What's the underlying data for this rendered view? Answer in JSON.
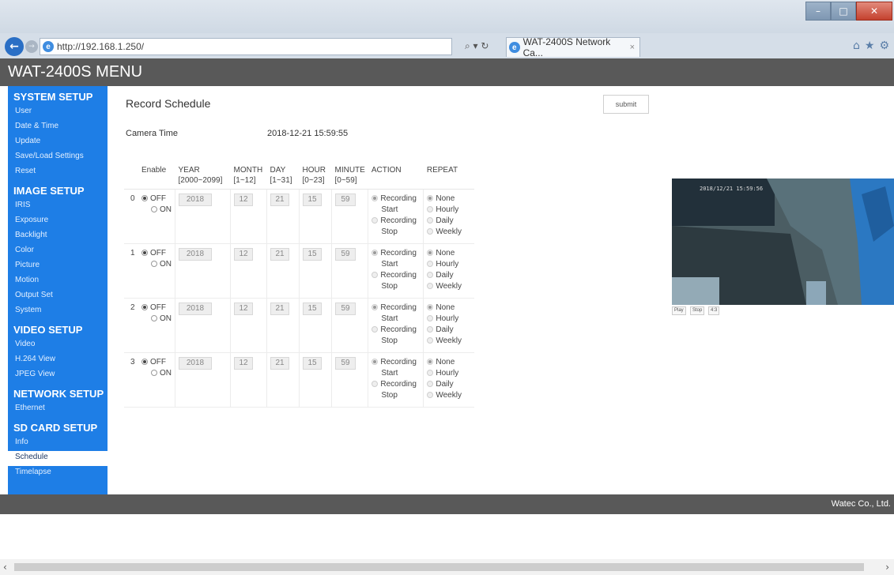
{
  "browser": {
    "url": "http://192.168.1.250/",
    "search_refresh": "⌕ ▾ ↻",
    "tab_title": "WAT-2400S Network Ca...",
    "tab_close": "×"
  },
  "app": {
    "header_title": "WAT-2400S MENU"
  },
  "sidebar": {
    "sections": [
      {
        "title": "SYSTEM SETUP",
        "items": [
          "User",
          "Date & Time",
          "Update",
          "Save/Load Settings",
          "Reset"
        ]
      },
      {
        "title": "IMAGE SETUP",
        "items": [
          "IRIS",
          "Exposure",
          "Backlight",
          "Color",
          "Picture",
          "Motion",
          "Output Set",
          "System"
        ]
      },
      {
        "title": "VIDEO SETUP",
        "items": [
          "Video",
          "H.264 View",
          "JPEG View"
        ]
      },
      {
        "title": "NETWORK SETUP",
        "items": [
          "Ethernet"
        ]
      },
      {
        "title": "SD CARD SETUP",
        "items": [
          "Info",
          "Schedule",
          "Timelapse"
        ]
      }
    ],
    "active_item": "Schedule"
  },
  "main": {
    "title": "Record Schedule",
    "submit_label": "submit",
    "camera_time_label": "Camera Time",
    "camera_time_value": "2018-12-21 15:59:55"
  },
  "schedule": {
    "headers": {
      "enable": "Enable",
      "year": "YEAR",
      "year_range": "[2000~2099]",
      "month": "MONTH",
      "month_range": "[1~12]",
      "day": "DAY",
      "day_range": "[1~31]",
      "hour": "HOUR",
      "hour_range": "[0~23]",
      "minute": "MINUTE",
      "minute_range": "[0~59]",
      "action": "ACTION",
      "repeat": "REPEAT"
    },
    "labels": {
      "off": "OFF",
      "on": "ON",
      "rec_start_1": "Recording",
      "rec_start_2": "Start",
      "rec_stop_1": "Recording",
      "rec_stop_2": "Stop",
      "none": "None",
      "hourly": "Hourly",
      "daily": "Daily",
      "weekly": "Weekly"
    },
    "rows": [
      {
        "index": "0",
        "year": "2018",
        "month": "12",
        "day": "21",
        "hour": "15",
        "minute": "59"
      },
      {
        "index": "1",
        "year": "2018",
        "month": "12",
        "day": "21",
        "hour": "15",
        "minute": "59"
      },
      {
        "index": "2",
        "year": "2018",
        "month": "12",
        "day": "21",
        "hour": "15",
        "minute": "59"
      },
      {
        "index": "3",
        "year": "2018",
        "month": "12",
        "day": "21",
        "hour": "15",
        "minute": "59"
      }
    ]
  },
  "preview": {
    "timestamp": "2018/12/21 15:59:56",
    "play_label": "Play",
    "stop_label": "Stop",
    "ratio_label": "4:3"
  },
  "footer": {
    "company": "Watec Co., Ltd."
  }
}
